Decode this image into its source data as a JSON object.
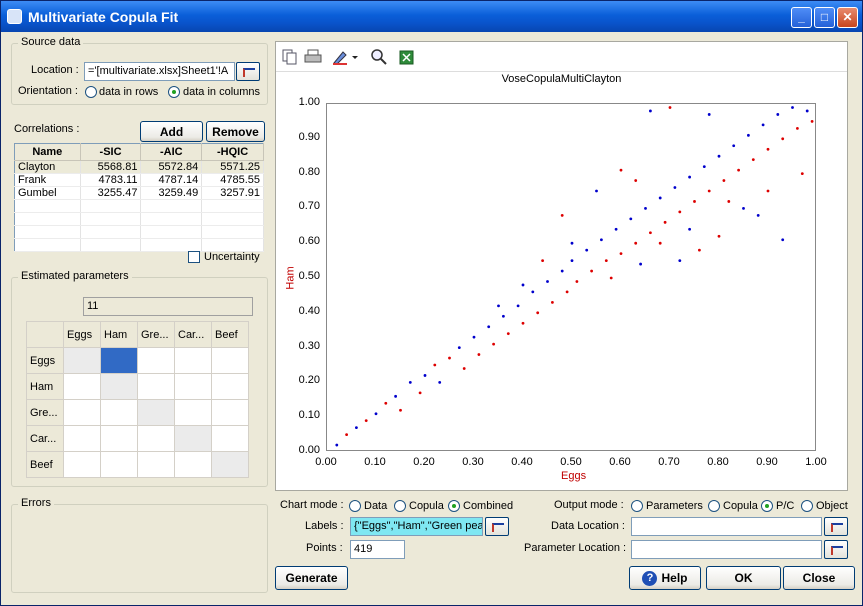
{
  "window": {
    "title": "Multivariate Copula Fit",
    "minimize": "_",
    "maximize": "□",
    "close": "✕"
  },
  "source_data": {
    "group_title": "Source data",
    "location_label": "Location :",
    "location_value": "='[multivariate.xlsx]Sheet1'!A",
    "orientation_label": "Orientation :",
    "orientation_options": [
      "data in rows",
      "data in columns"
    ],
    "orientation_selected": "data in columns"
  },
  "correlations": {
    "label": "Correlations :",
    "add_label": "Add",
    "remove_label": "Remove",
    "columns": [
      "Name",
      "-SIC",
      "-AIC",
      "-HQIC"
    ],
    "rows": [
      [
        "Clayton",
        "5568.81",
        "5572.84",
        "5571.25"
      ],
      [
        "Frank",
        "4783.11",
        "4787.14",
        "4785.55"
      ],
      [
        "Gumbel",
        "3255.47",
        "3259.49",
        "3257.91"
      ]
    ],
    "selected_row": "Clayton",
    "uncertainty_label": "Uncertainty",
    "uncertainty_checked": false
  },
  "estimated_parameters": {
    "group_title": "Estimated parameters",
    "value": "11",
    "headers": [
      "Eggs",
      "Ham",
      "Gre...",
      "Car...",
      "Beef"
    ]
  },
  "errors": {
    "group_title": "Errors"
  },
  "chart": {
    "toolbar_icons": [
      "copy-icon",
      "print-icon",
      "chart-style-icon",
      "zoom-icon",
      "export-excel-icon"
    ],
    "chart_data": {
      "type": "scatter",
      "title": "VoseCopulaMultiClayton",
      "xlabel": "Eggs",
      "ylabel": "Ham",
      "xlim": [
        0,
        1
      ],
      "ylim": [
        0,
        1
      ],
      "xticks": [
        "0.00",
        "0.10",
        "0.20",
        "0.30",
        "0.40",
        "0.50",
        "0.60",
        "0.70",
        "0.80",
        "0.90",
        "1.00"
      ],
      "yticks": [
        "0.00",
        "0.10",
        "0.20",
        "0.30",
        "0.40",
        "0.50",
        "0.60",
        "0.70",
        "0.80",
        "0.90",
        "1.00"
      ],
      "series_colors": [
        "#0000cc",
        "#dd0000"
      ],
      "sample_points": [
        [
          0.02,
          0.02
        ],
        [
          0.04,
          0.05
        ],
        [
          0.06,
          0.07
        ],
        [
          0.08,
          0.09
        ],
        [
          0.1,
          0.11
        ],
        [
          0.12,
          0.14
        ],
        [
          0.14,
          0.16
        ],
        [
          0.15,
          0.12
        ],
        [
          0.17,
          0.2
        ],
        [
          0.19,
          0.17
        ],
        [
          0.2,
          0.22
        ],
        [
          0.22,
          0.25
        ],
        [
          0.23,
          0.2
        ],
        [
          0.25,
          0.27
        ],
        [
          0.27,
          0.3
        ],
        [
          0.28,
          0.24
        ],
        [
          0.3,
          0.33
        ],
        [
          0.31,
          0.28
        ],
        [
          0.33,
          0.36
        ],
        [
          0.34,
          0.31
        ],
        [
          0.36,
          0.39
        ],
        [
          0.37,
          0.34
        ],
        [
          0.39,
          0.42
        ],
        [
          0.4,
          0.37
        ],
        [
          0.42,
          0.46
        ],
        [
          0.43,
          0.4
        ],
        [
          0.45,
          0.49
        ],
        [
          0.46,
          0.43
        ],
        [
          0.48,
          0.52
        ],
        [
          0.49,
          0.46
        ],
        [
          0.5,
          0.55
        ],
        [
          0.51,
          0.49
        ],
        [
          0.53,
          0.58
        ],
        [
          0.54,
          0.52
        ],
        [
          0.56,
          0.61
        ],
        [
          0.57,
          0.55
        ],
        [
          0.59,
          0.64
        ],
        [
          0.6,
          0.57
        ],
        [
          0.62,
          0.67
        ],
        [
          0.63,
          0.6
        ],
        [
          0.65,
          0.7
        ],
        [
          0.66,
          0.63
        ],
        [
          0.68,
          0.73
        ],
        [
          0.69,
          0.66
        ],
        [
          0.71,
          0.76
        ],
        [
          0.72,
          0.69
        ],
        [
          0.74,
          0.79
        ],
        [
          0.75,
          0.72
        ],
        [
          0.77,
          0.82
        ],
        [
          0.78,
          0.75
        ],
        [
          0.8,
          0.85
        ],
        [
          0.81,
          0.78
        ],
        [
          0.83,
          0.88
        ],
        [
          0.84,
          0.81
        ],
        [
          0.86,
          0.91
        ],
        [
          0.87,
          0.84
        ],
        [
          0.89,
          0.94
        ],
        [
          0.9,
          0.87
        ],
        [
          0.92,
          0.97
        ],
        [
          0.93,
          0.9
        ],
        [
          0.95,
          0.99
        ],
        [
          0.96,
          0.93
        ],
        [
          0.98,
          0.98
        ],
        [
          0.99,
          0.95
        ],
        [
          0.55,
          0.75
        ],
        [
          0.6,
          0.81
        ],
        [
          0.66,
          0.98
        ],
        [
          0.7,
          0.99
        ],
        [
          0.78,
          0.97
        ],
        [
          0.48,
          0.68
        ],
        [
          0.5,
          0.6
        ],
        [
          0.63,
          0.78
        ],
        [
          0.72,
          0.55
        ],
        [
          0.8,
          0.62
        ],
        [
          0.85,
          0.7
        ],
        [
          0.9,
          0.75
        ],
        [
          0.93,
          0.61
        ],
        [
          0.97,
          0.8
        ],
        [
          0.88,
          0.68
        ],
        [
          0.76,
          0.58
        ],
        [
          0.4,
          0.48
        ],
        [
          0.44,
          0.55
        ],
        [
          0.35,
          0.42
        ],
        [
          0.58,
          0.5
        ],
        [
          0.64,
          0.54
        ],
        [
          0.68,
          0.6
        ],
        [
          0.74,
          0.64
        ],
        [
          0.82,
          0.72
        ]
      ]
    }
  },
  "chart_mode": {
    "label": "Chart mode :",
    "options": [
      "Data",
      "Copula",
      "Combined"
    ],
    "selected": "Combined"
  },
  "output_mode": {
    "label": "Output mode :",
    "options": [
      "Parameters",
      "Copula",
      "P/C",
      "Object"
    ],
    "selected": "P/C"
  },
  "labels_field": {
    "label": "Labels :",
    "value": "{\"Eggs\",\"Ham\",\"Green pea"
  },
  "points_field": {
    "label": "Points :",
    "value": "419"
  },
  "data_location": {
    "label": "Data Location :",
    "value": ""
  },
  "parameter_location": {
    "label": "Parameter Location :",
    "value": ""
  },
  "buttons": {
    "generate": "Generate",
    "help": "Help",
    "ok": "OK",
    "close": "Close"
  }
}
